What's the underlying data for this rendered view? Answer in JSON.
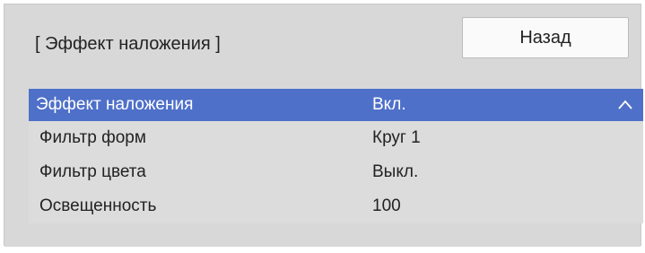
{
  "header": {
    "title": "[ Эффект наложения ]",
    "back_label": "Назад"
  },
  "menu": {
    "rows": [
      {
        "label": "Эффект наложения",
        "value": "Вкл.",
        "selected": true,
        "icon": "chevron-up-icon"
      },
      {
        "label": "Фильтр форм",
        "value": "Круг 1"
      },
      {
        "label": "Фильтр цвета",
        "value": "Выкл."
      },
      {
        "label": "Освещенность",
        "value": "100"
      }
    ]
  },
  "colors": {
    "selection": "#4f70c9",
    "panel": "#d8d8d8",
    "button": "#fafafa"
  }
}
